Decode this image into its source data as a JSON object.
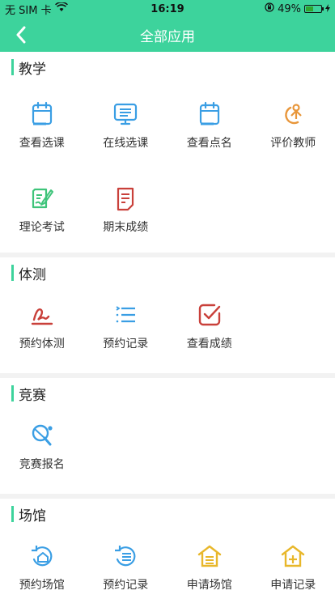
{
  "status_bar": {
    "carrier": "无 SIM 卡",
    "time": "16:19",
    "battery": "49%",
    "battery_level": 0.49
  },
  "nav": {
    "title": "全部应用"
  },
  "sections": {
    "teaching": {
      "title": "教学",
      "items": [
        {
          "label": "查看选课",
          "icon": "calendar-icon",
          "color": "#3a9ee4"
        },
        {
          "label": "在线选课",
          "icon": "monitor-icon",
          "color": "#3a9ee4"
        },
        {
          "label": "查看点名",
          "icon": "calendar-icon",
          "color": "#3a9ee4"
        },
        {
          "label": "评价教师",
          "icon": "teacher-icon",
          "color": "#e8963a"
        },
        {
          "label": "理论考试",
          "icon": "exam-icon",
          "color": "#3ec47a"
        },
        {
          "label": "期末成绩",
          "icon": "report-icon",
          "color": "#c9403a"
        }
      ]
    },
    "fitness": {
      "title": "体测",
      "items": [
        {
          "label": "预约体测",
          "icon": "signature-icon",
          "color": "#c9403a"
        },
        {
          "label": "预约记录",
          "icon": "list-icon",
          "color": "#3a9ee4"
        },
        {
          "label": "查看成绩",
          "icon": "checkbox-icon",
          "color": "#c9403a"
        }
      ]
    },
    "competition": {
      "title": "竞赛",
      "items": [
        {
          "label": "竞赛报名",
          "icon": "pingpong-icon",
          "color": "#3a9ee4"
        }
      ]
    },
    "venue": {
      "title": "场馆",
      "items": [
        {
          "label": "预约场馆",
          "icon": "home-refresh-icon",
          "color": "#3a9ee4"
        },
        {
          "label": "预约记录",
          "icon": "list-refresh-icon",
          "color": "#3a9ee4"
        },
        {
          "label": "申请场馆",
          "icon": "house-list-icon",
          "color": "#e8b72a"
        },
        {
          "label": "申请记录",
          "icon": "house-plus-icon",
          "color": "#e8b72a"
        }
      ]
    }
  }
}
